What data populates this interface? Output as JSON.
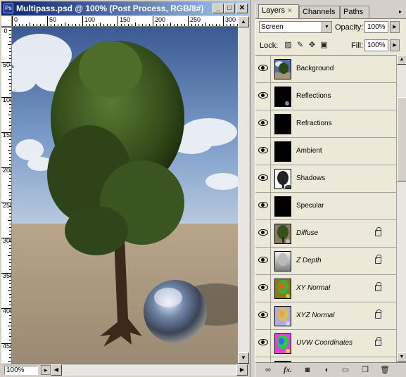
{
  "document": {
    "title": "Multipass.psd @ 100% (Post Process, RGB/8#)",
    "zoom": "100%",
    "ruler_h": [
      "0",
      "50",
      "100",
      "150",
      "200",
      "250",
      "300"
    ],
    "ruler_v": [
      "0",
      "50",
      "100",
      "150",
      "200",
      "250",
      "300",
      "350",
      "400",
      "450"
    ],
    "window_buttons": {
      "minimize": "_",
      "maximize": "□",
      "close": "✕"
    }
  },
  "panel": {
    "tabs": [
      {
        "label": "Layers",
        "active": true
      },
      {
        "label": "Channels",
        "active": false
      },
      {
        "label": "Paths",
        "active": false
      }
    ],
    "tab_close": "✕",
    "blend_mode": "Screen",
    "opacity_label": "Opacity:",
    "opacity": "100%",
    "lock_label": "Lock:",
    "fill_label": "Fill:",
    "fill": "100%",
    "layers": [
      {
        "name": "Background",
        "visible": true,
        "italic": false,
        "locked": false,
        "thumb": "background-thumb"
      },
      {
        "name": "Reflections",
        "visible": true,
        "italic": false,
        "locked": false,
        "thumb": "reflections-thumb"
      },
      {
        "name": "Refractions",
        "visible": true,
        "italic": false,
        "locked": false,
        "thumb": "black-thumb"
      },
      {
        "name": "Ambient",
        "visible": true,
        "italic": false,
        "locked": false,
        "thumb": "black-thumb"
      },
      {
        "name": "Shadows",
        "visible": true,
        "italic": false,
        "locked": false,
        "thumb": "shadows-thumb"
      },
      {
        "name": "Specular",
        "visible": true,
        "italic": false,
        "locked": false,
        "thumb": "black-thumb"
      },
      {
        "name": "Diffuse",
        "visible": true,
        "italic": true,
        "locked": true,
        "thumb": "diffuse-thumb"
      },
      {
        "name": "Z Depth",
        "visible": true,
        "italic": true,
        "locked": true,
        "thumb": "zdepth-thumb"
      },
      {
        "name": "XY Normal",
        "visible": true,
        "italic": true,
        "locked": true,
        "thumb": "xynormal-thumb"
      },
      {
        "name": "XYZ Normal",
        "visible": true,
        "italic": true,
        "locked": true,
        "thumb": "xyznormal-thumb"
      },
      {
        "name": "UVW Coordinates",
        "visible": true,
        "italic": true,
        "locked": true,
        "thumb": "uvw-thumb"
      },
      {
        "name": "",
        "visible": true,
        "italic": false,
        "locked": false,
        "thumb": "black-thumb"
      }
    ],
    "bottom_icons": [
      "link-icon",
      "fx-icon",
      "mask-icon",
      "adjustment-icon",
      "folder-icon",
      "new-layer-icon",
      "trash-icon"
    ],
    "bottom_fx_label": "fx."
  }
}
